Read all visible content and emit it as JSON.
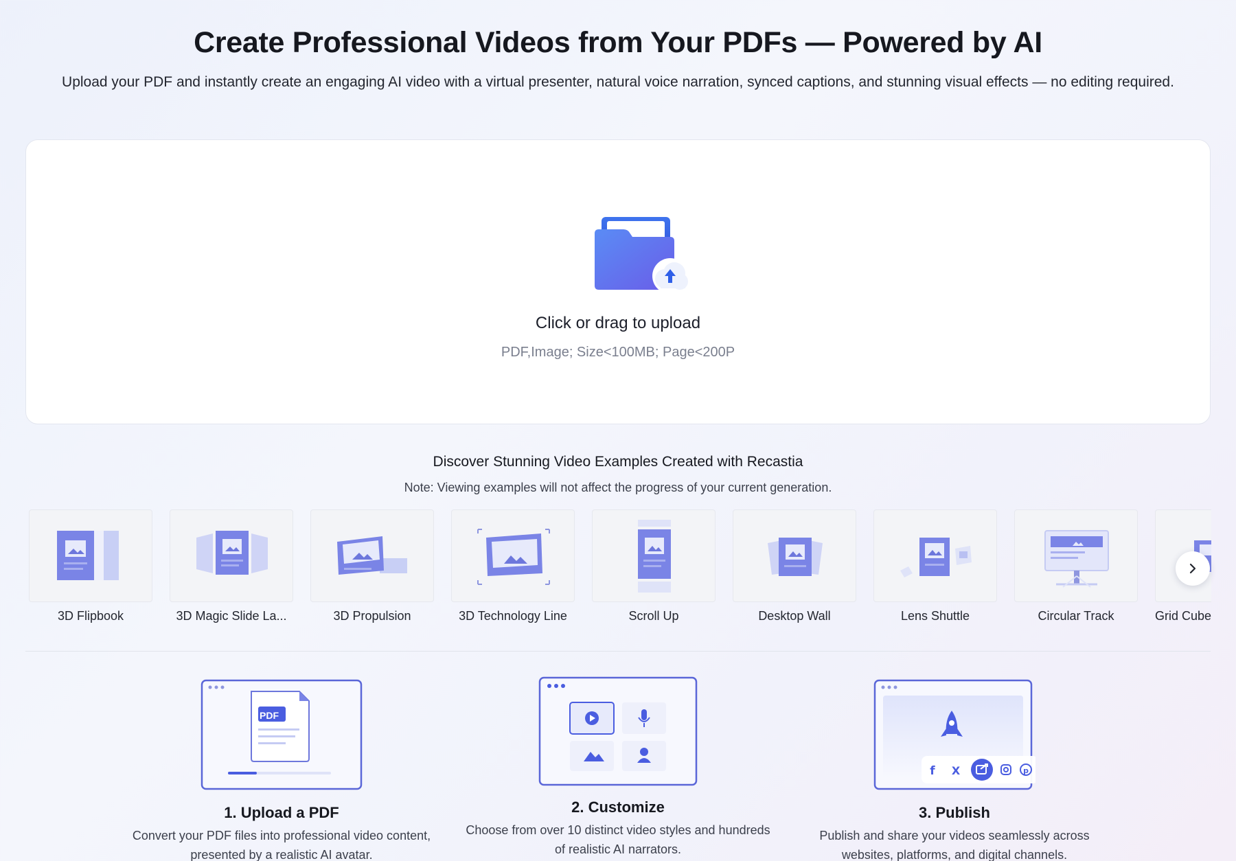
{
  "hero": {
    "title": "Create Professional Videos from Your PDFs — Powered by AI",
    "subtitle": "Upload your PDF and instantly create an engaging AI video with a virtual presenter, natural voice narration, synced captions, and stunning visual effects — no editing required."
  },
  "upload": {
    "title": "Click or drag to upload",
    "hint": "PDF,Image; Size<100MB; Page<200P",
    "icon": "folder-upload-icon"
  },
  "examples": {
    "title": "Discover Stunning Video Examples Created with Recastia",
    "note": "Note: Viewing examples will not affect the progress of your current generation.",
    "items": [
      {
        "label": "3D Flipbook"
      },
      {
        "label": "3D Magic Slide La..."
      },
      {
        "label": "3D Propulsion"
      },
      {
        "label": "3D Technology Line"
      },
      {
        "label": "Scroll Up"
      },
      {
        "label": "Desktop Wall"
      },
      {
        "label": "Lens Shuttle"
      },
      {
        "label": "Circular Track"
      },
      {
        "label": "Grid Cube"
      }
    ],
    "next_icon": "chevron-right-icon"
  },
  "steps": [
    {
      "title": "1. Upload a PDF",
      "desc": "Convert your PDF files into professional video content, presented by a realistic AI avatar.",
      "badge": "PDF"
    },
    {
      "title": "2. Customize",
      "desc": "Choose from over 10 distinct video styles and hundreds of realistic AI narrators."
    },
    {
      "title": "3. Publish",
      "desc": "Publish and share your videos seamlessly across websites, platforms, and digital channels."
    }
  ],
  "colors": {
    "accent": "#4a5de0",
    "accent_light": "#8fa0f5",
    "text": "#16181f",
    "muted": "#7a7f8e"
  }
}
